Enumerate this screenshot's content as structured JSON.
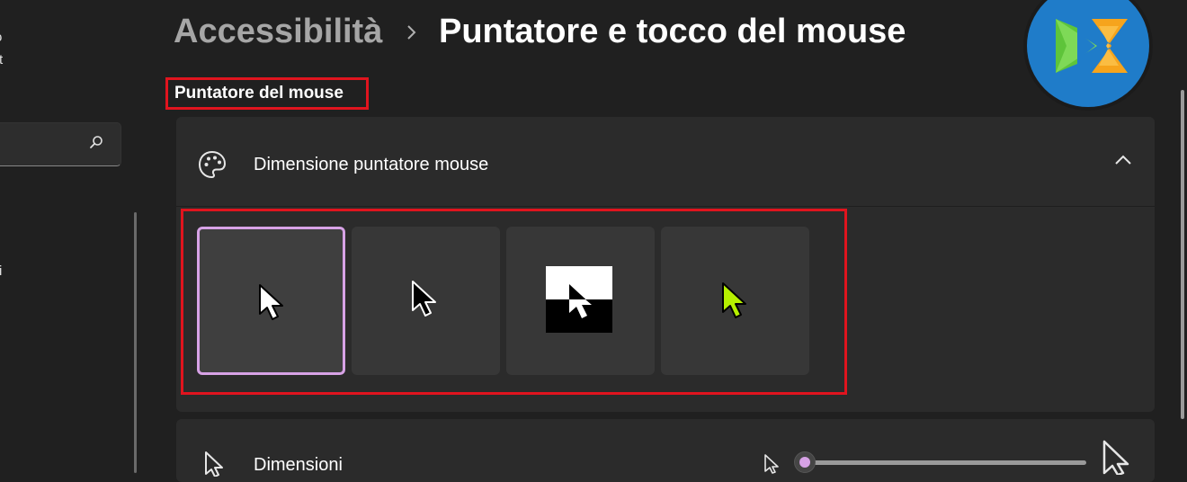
{
  "sidebar": {
    "fragment_top": "o",
    "fragment_t": "t",
    "fragment_i": "i"
  },
  "breadcrumb": {
    "parent": "Accessibilità",
    "current": "Puntatore e tocco del mouse"
  },
  "section": {
    "heading": "Puntatore del mouse"
  },
  "pointer_size_card": {
    "title": "Dimensione puntatore mouse",
    "expanded": true,
    "options": [
      {
        "style": "white",
        "selected": true
      },
      {
        "style": "black",
        "selected": false
      },
      {
        "style": "inverted",
        "selected": false
      },
      {
        "style": "custom",
        "selected": false,
        "color": "#b6f000"
      }
    ]
  },
  "size_card": {
    "label": "Dimensioni",
    "slider_value": 1
  },
  "colors": {
    "accent": "#d7a2e6",
    "highlight": "#e0141e",
    "custom_pointer": "#b6f000"
  }
}
